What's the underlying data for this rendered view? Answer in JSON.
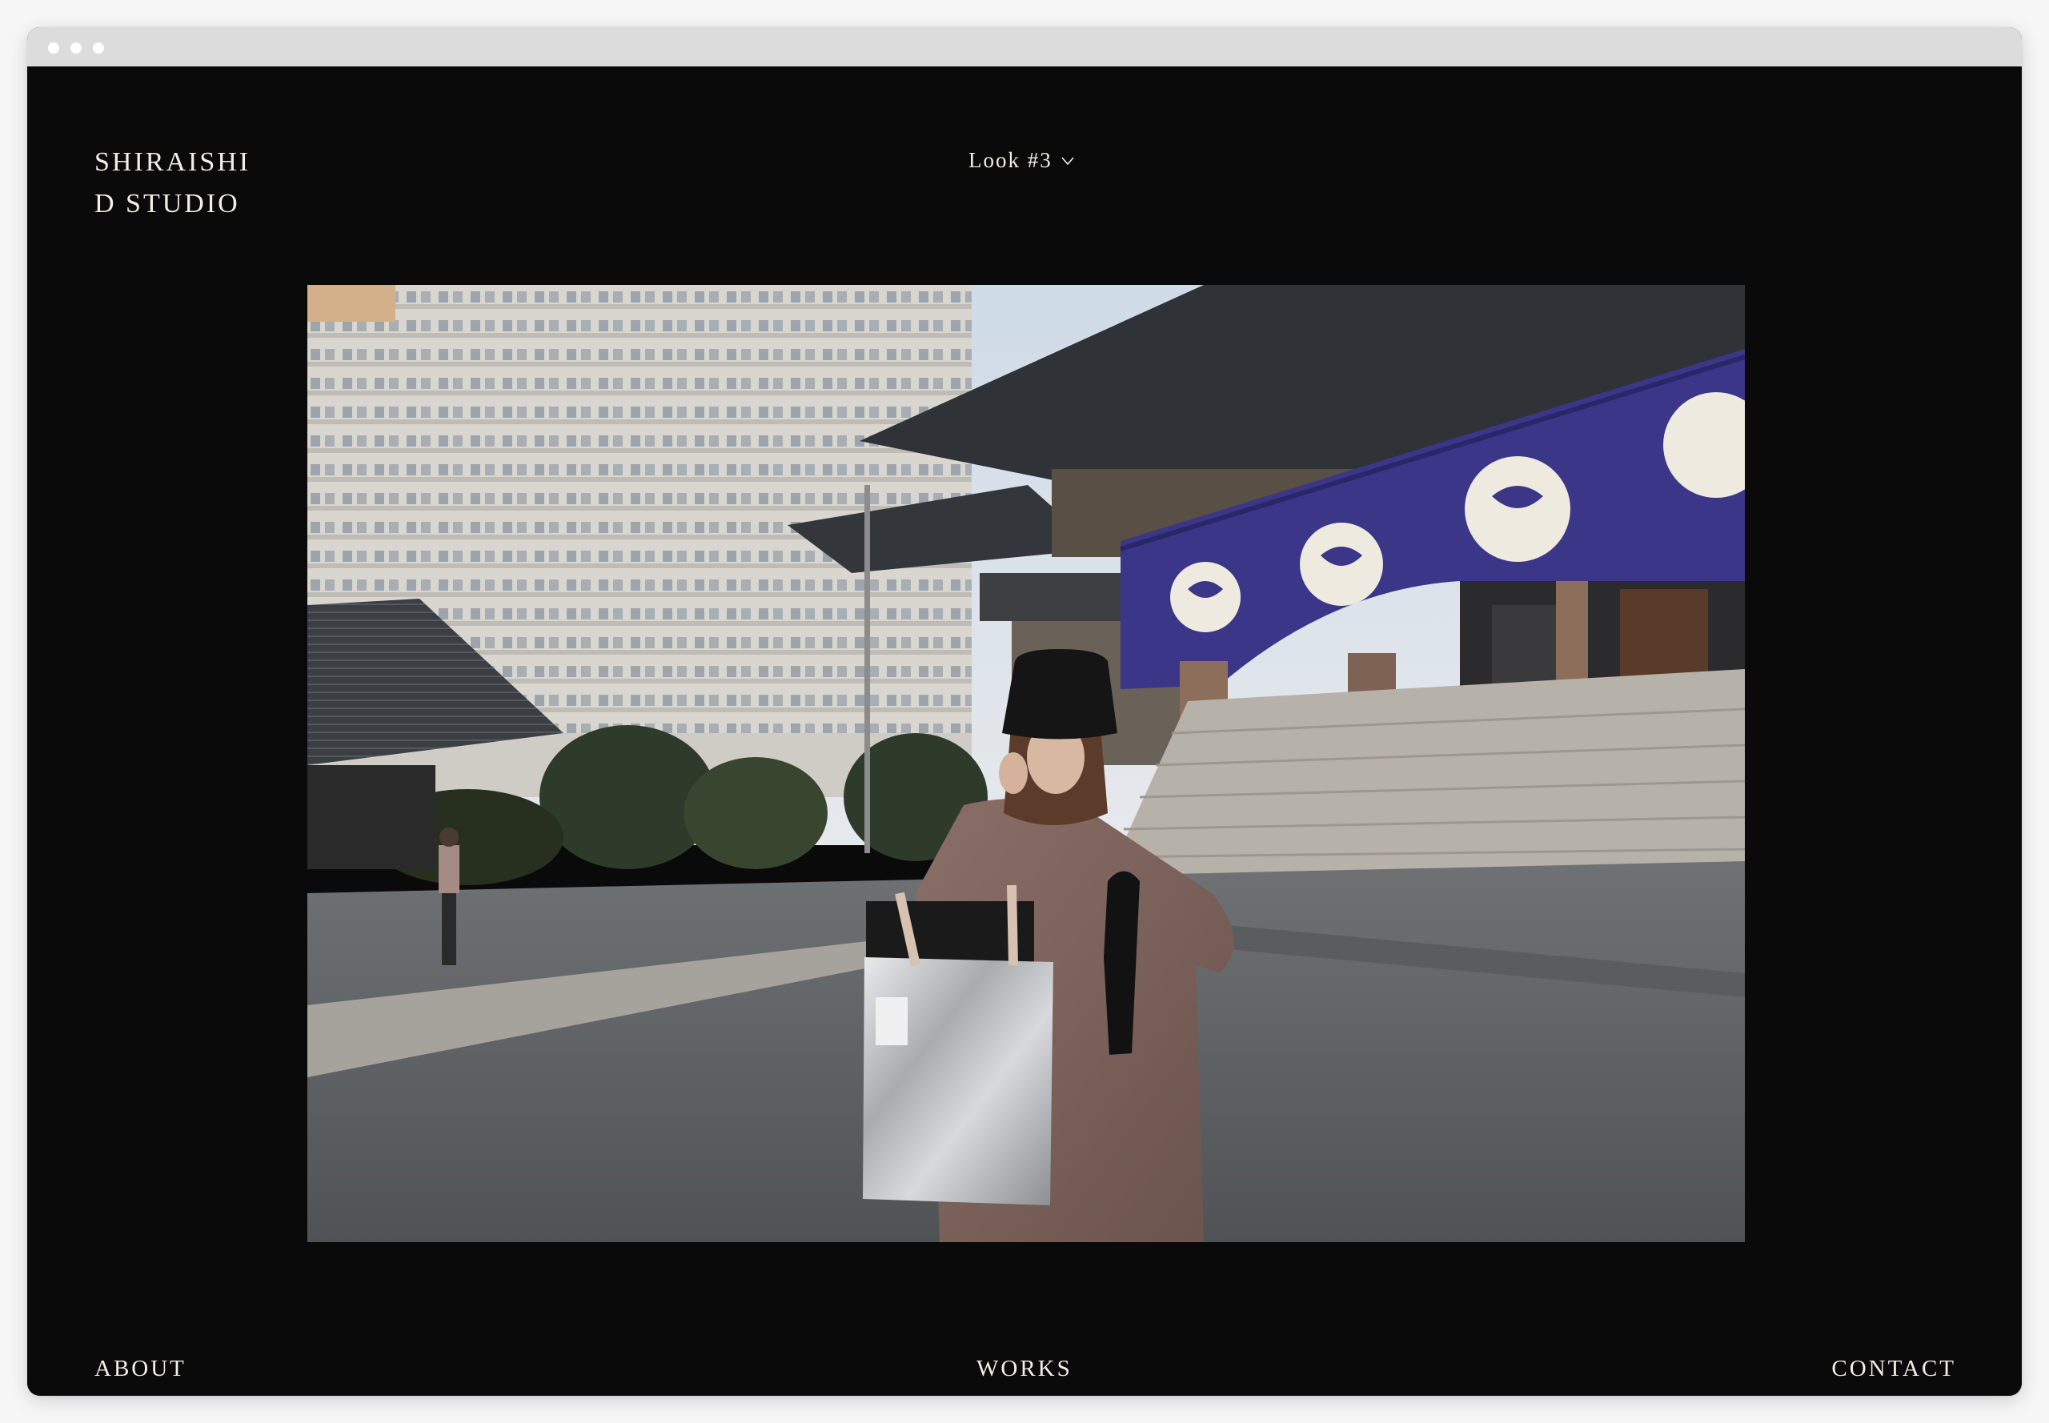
{
  "brand": {
    "line1": "SHIRAISHI",
    "line2": "D STUDIO"
  },
  "look_selector": {
    "label": "Look #3",
    "icon": "chevron-down-icon"
  },
  "hero_image": {
    "alt": "Look #3"
  },
  "footer_nav": {
    "about": "ABOUT",
    "works": "WORKS",
    "contact": "CONTACT"
  },
  "colors": {
    "background": "#0a0a0a",
    "text": "#f2efe8",
    "banner_purple": "#3b3688"
  }
}
